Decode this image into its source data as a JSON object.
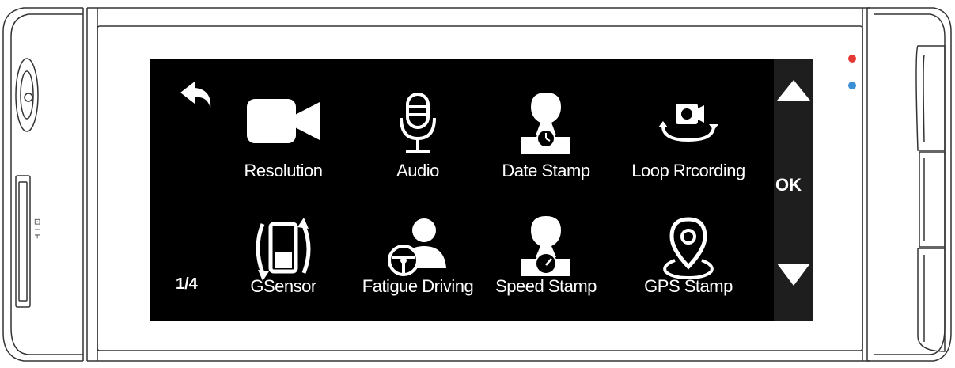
{
  "page": {
    "indicator": "1/4",
    "ok_label": "OK"
  },
  "colors": {
    "screen_bg": "#000000",
    "sidebar_bg": "#1e1e1e",
    "text": "#ffffff",
    "led_red": "#e53935",
    "led_blue": "#3d8fd6"
  },
  "menu": {
    "items": [
      {
        "label": "Resolution",
        "icon": "video-camera-icon"
      },
      {
        "label": "Audio",
        "icon": "microphone-icon"
      },
      {
        "label": "Date Stamp",
        "icon": "stamp-clock-icon"
      },
      {
        "label": "Loop Rrcording",
        "icon": "loop-camera-icon"
      },
      {
        "label": "GSensor",
        "icon": "rotate-device-icon"
      },
      {
        "label": "Fatigue Driving",
        "icon": "driver-wheel-icon"
      },
      {
        "label": "Speed Stamp",
        "icon": "stamp-speed-icon"
      },
      {
        "label": "GPS Stamp",
        "icon": "location-pin-icon"
      }
    ]
  }
}
